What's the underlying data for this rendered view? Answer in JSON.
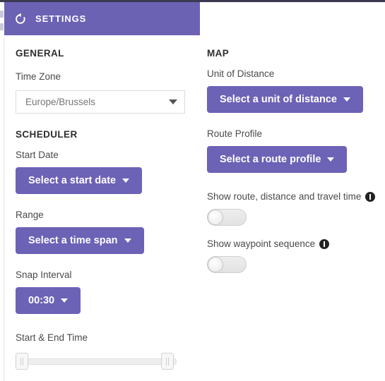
{
  "header": {
    "title": "SETTINGS",
    "icon": "reset-rotate-icon",
    "background_color": "#6b62b4"
  },
  "theme": {
    "purple": "#6b62b4",
    "button_purple": "#6c62b6",
    "top_rule": "#3b3a52",
    "label_gray": "#4a4a4a",
    "value_gray": "#777777"
  },
  "left_column": {
    "general": {
      "section_title": "GENERAL",
      "time_zone": {
        "label": "Time Zone",
        "value": "Europe/Brussels"
      }
    },
    "scheduler": {
      "section_title": "SCHEDULER",
      "start_date": {
        "label": "Start Date",
        "button_label": "Select a start date"
      },
      "range": {
        "label": "Range",
        "button_label": "Select a time span"
      },
      "snap_interval": {
        "label": "Snap Interval",
        "button_label": "00:30"
      },
      "start_end_time": {
        "label": "Start & End Time",
        "slider_min_percent": 0,
        "slider_max_percent": 100
      }
    }
  },
  "right_column": {
    "map": {
      "section_title": "MAP",
      "unit_of_distance": {
        "label": "Unit of Distance",
        "button_label": "Select a unit of distance"
      },
      "route_profile": {
        "label": "Route Profile",
        "button_label": "Select a route profile"
      },
      "show_route": {
        "label": "Show route, distance and travel time",
        "info_icon": "info-icon",
        "toggle_state": "off"
      },
      "show_waypoint_sequence": {
        "label": "Show waypoint sequence",
        "info_icon": "info-icon",
        "toggle_state": "off"
      }
    }
  }
}
